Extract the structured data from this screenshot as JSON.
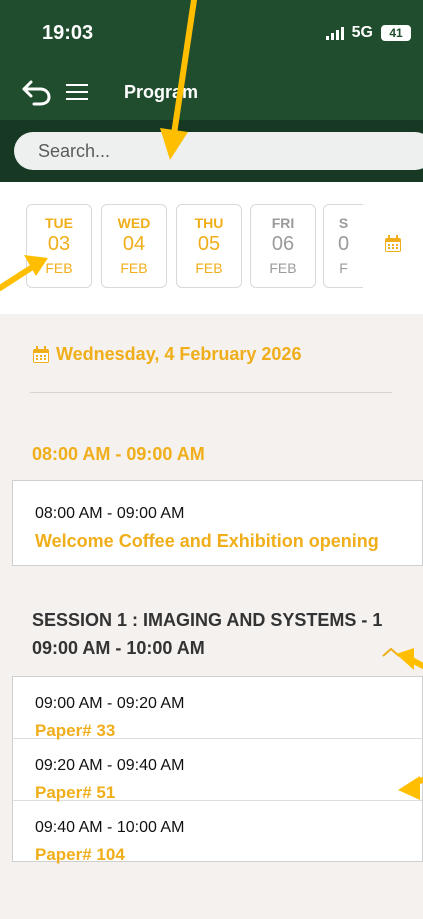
{
  "status": {
    "time": "19:03",
    "network": "5G",
    "battery": "41"
  },
  "appbar": {
    "title": "Program"
  },
  "search": {
    "placeholder": "Search..."
  },
  "dates": [
    {
      "dow": "TUE",
      "day": "03",
      "month": "FEB",
      "active": true
    },
    {
      "dow": "WED",
      "day": "04",
      "month": "FEB",
      "active": true
    },
    {
      "dow": "THU",
      "day": "05",
      "month": "FEB",
      "active": true
    },
    {
      "dow": "FRI",
      "day": "06",
      "month": "FEB",
      "active": false
    },
    {
      "dow": "S",
      "day": "0",
      "month": "F",
      "active": false
    }
  ],
  "date_heading": "Wednesday, 4 February 2026",
  "slot_title": "08:00 AM - 09:00 AM",
  "welcome": {
    "time": "08:00 AM - 09:00 AM",
    "title": "Welcome Coffee and Exhibition opening"
  },
  "session": {
    "title": "SESSION 1 : IMAGING AND SYSTEMS - 1",
    "time": "09:00 AM - 10:00 AM"
  },
  "papers": [
    {
      "time": "09:00 AM - 09:20 AM",
      "title": "Paper# 33"
    },
    {
      "time": "09:20 AM - 09:40 AM",
      "title": "Paper# 51"
    },
    {
      "time": "09:40 AM - 10:00 AM",
      "title": "Paper# 104"
    }
  ],
  "colors": {
    "header": "#1f4d2e",
    "accent": "#f0ae1a",
    "annotation": "#ffbf00"
  }
}
